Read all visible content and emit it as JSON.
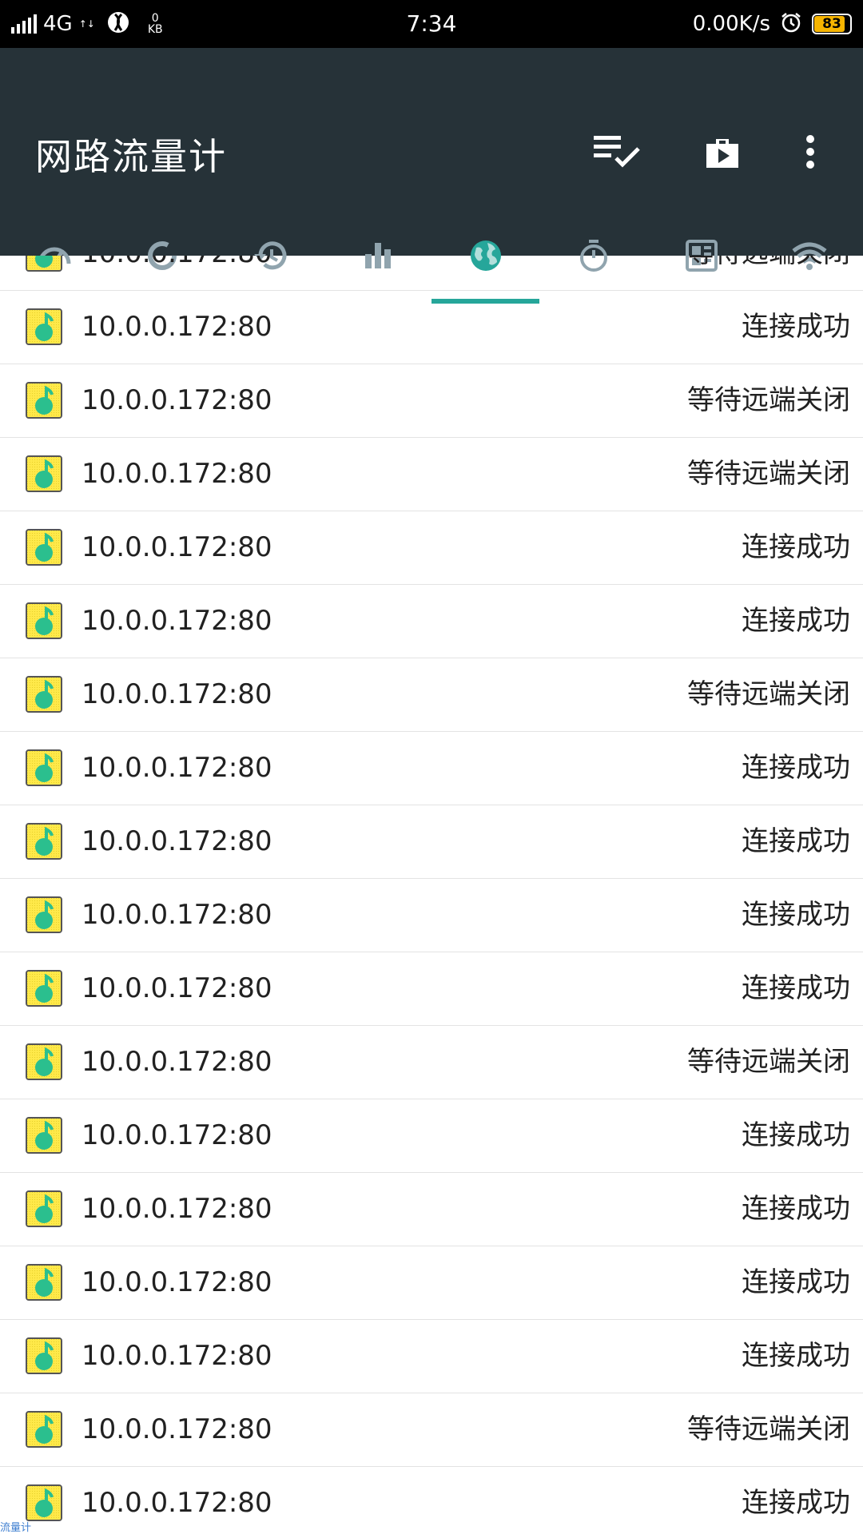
{
  "status_bar": {
    "network": "4G",
    "network_sub": "↑↓",
    "speed_top": "0",
    "speed_unit": "KB",
    "time": "7:34",
    "net_speed": "0.00K/s",
    "battery": "83"
  },
  "app_bar": {
    "title": "网路流量计"
  },
  "tabs": [
    {
      "icon": "speedometer-icon",
      "active": false
    },
    {
      "icon": "refresh-icon",
      "active": false
    },
    {
      "icon": "history-icon",
      "active": false
    },
    {
      "icon": "bar-chart-icon",
      "active": false
    },
    {
      "icon": "globe-icon",
      "active": true
    },
    {
      "icon": "timer-icon",
      "active": false
    },
    {
      "icon": "dashboard-icon",
      "active": false
    },
    {
      "icon": "wifi-icon",
      "active": false
    }
  ],
  "connections": [
    {
      "address": "10.0.0.172:80",
      "state": "等待远端关闭"
    },
    {
      "address": "10.0.0.172:80",
      "state": "连接成功"
    },
    {
      "address": "10.0.0.172:80",
      "state": "等待远端关闭"
    },
    {
      "address": "10.0.0.172:80",
      "state": "等待远端关闭"
    },
    {
      "address": "10.0.0.172:80",
      "state": "连接成功"
    },
    {
      "address": "10.0.0.172:80",
      "state": "连接成功"
    },
    {
      "address": "10.0.0.172:80",
      "state": "等待远端关闭"
    },
    {
      "address": "10.0.0.172:80",
      "state": "连接成功"
    },
    {
      "address": "10.0.0.172:80",
      "state": "连接成功"
    },
    {
      "address": "10.0.0.172:80",
      "state": "连接成功"
    },
    {
      "address": "10.0.0.172:80",
      "state": "连接成功"
    },
    {
      "address": "10.0.0.172:80",
      "state": "等待远端关闭"
    },
    {
      "address": "10.0.0.172:80",
      "state": "连接成功"
    },
    {
      "address": "10.0.0.172:80",
      "state": "连接成功"
    },
    {
      "address": "10.0.0.172:80",
      "state": "连接成功"
    },
    {
      "address": "10.0.0.172:80",
      "state": "连接成功"
    },
    {
      "address": "10.0.0.172:80",
      "state": "等待远端关闭"
    },
    {
      "address": "10.0.0.172:80",
      "state": "连接成功"
    }
  ],
  "colors": {
    "app_bar": "#263238",
    "accent": "#26a69a",
    "tab_icon": "#90a4ae",
    "app_icon_bg": "#ffe94a",
    "app_icon_note": "#2bbf8e"
  }
}
